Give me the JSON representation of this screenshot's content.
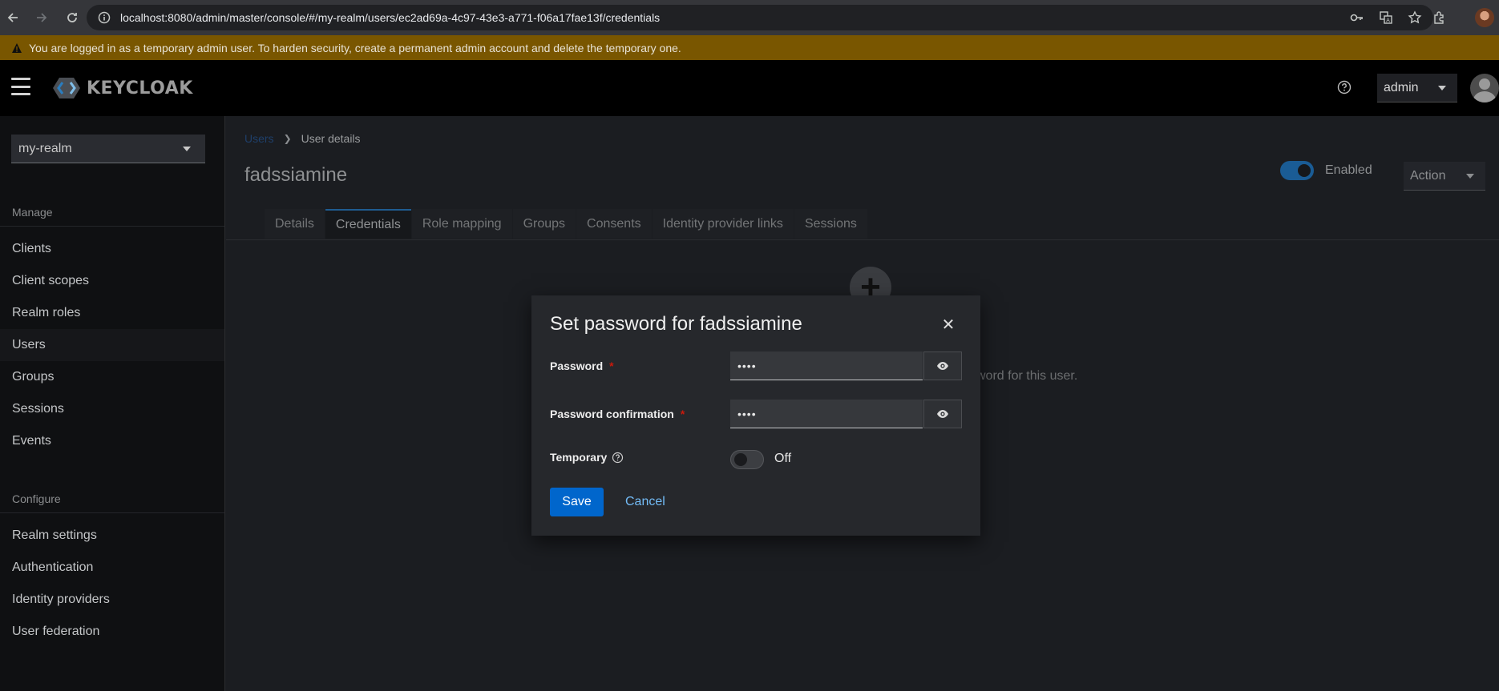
{
  "browser": {
    "url": "localhost:8080/admin/master/console/#/my-realm/users/ec2ad69a-4c97-43e3-a771-f06a17fae13f/credentials"
  },
  "banner": {
    "text": "You are logged in as a temporary admin user. To harden security, create a permanent admin account and delete the temporary one."
  },
  "masthead": {
    "logo_text": "KEYCLOAK",
    "user_label": "admin"
  },
  "sidebar": {
    "realm": "my-realm",
    "manage_heading": "Manage",
    "manage_items": [
      {
        "label": "Clients"
      },
      {
        "label": "Client scopes"
      },
      {
        "label": "Realm roles"
      },
      {
        "label": "Users"
      },
      {
        "label": "Groups"
      },
      {
        "label": "Sessions"
      },
      {
        "label": "Events"
      }
    ],
    "configure_heading": "Configure",
    "configure_items": [
      {
        "label": "Realm settings"
      },
      {
        "label": "Authentication"
      },
      {
        "label": "Identity providers"
      },
      {
        "label": "User federation"
      }
    ]
  },
  "main": {
    "breadcrumb": {
      "parent": "Users",
      "current": "User details"
    },
    "title": "fadssiamine",
    "enabled_label": "Enabled",
    "action_label": "Action",
    "tabs": [
      {
        "label": "Details"
      },
      {
        "label": "Credentials"
      },
      {
        "label": "Role mapping"
      },
      {
        "label": "Groups"
      },
      {
        "label": "Consents"
      },
      {
        "label": "Identity provider links"
      },
      {
        "label": "Sessions"
      }
    ],
    "empty_text_visible": "sword for this user."
  },
  "modal": {
    "title": "Set password for fadssiamine",
    "password_label": "Password",
    "password_value": "••••",
    "confirm_label": "Password confirmation",
    "confirm_value": "••••",
    "temporary_label": "Temporary",
    "temporary_state": "Off",
    "save_label": "Save",
    "cancel_label": "Cancel",
    "required_marker": "*"
  },
  "colors": {
    "banner": "#795600",
    "primary": "#0066cc",
    "link": "#73bcf7",
    "required": "#c9190b"
  }
}
